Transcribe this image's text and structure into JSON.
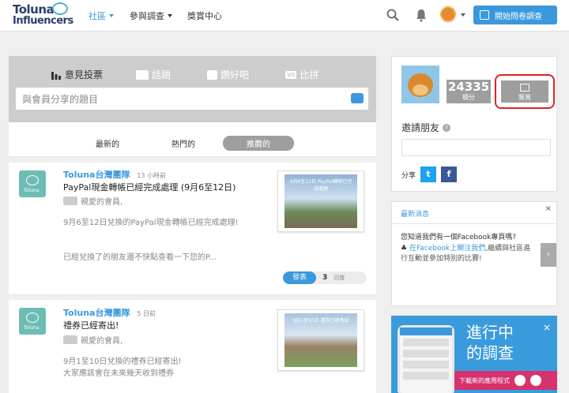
{
  "brand": {
    "line1": "Toluna",
    "line2": "Influencers"
  },
  "nav": {
    "items": [
      {
        "label": "社區"
      },
      {
        "label": "參與調查"
      },
      {
        "label": "獎賞中心"
      }
    ],
    "cta_label": "開始問卷調查"
  },
  "composer": {
    "tabs": [
      {
        "label": "意見投票"
      },
      {
        "label": "話題"
      },
      {
        "label": "讚好吧"
      },
      {
        "label": "比拼",
        "badge": "VS"
      }
    ],
    "placeholder": "與會員分享的題目"
  },
  "sort_tabs": [
    {
      "label": "最新的"
    },
    {
      "label": "熱門的"
    },
    {
      "label": "推薦的"
    }
  ],
  "posts": [
    {
      "author": "Toluna台灣團隊",
      "time": "13 小時前",
      "title": "PayPal現金轉帳已經完成處理 (9月6至12日)",
      "greeting": "親愛的會員,",
      "body1": "9月6至12日兌換的PayPal現金轉帳已經完成處理!",
      "body2": "已經兌換了的朋友還不快點查看一下您的P...",
      "thumb_caption": "9月6至12日 PayPal轉帳已完成處理",
      "publish_label": "發表",
      "comment_count": "3",
      "reply_label": "回覆"
    },
    {
      "author": "Toluna台灣團隊",
      "time": "5 日前",
      "title": "禮券已經寄出!",
      "greeting": "親愛的會員,",
      "body1": "9月1至10日兌換的禮券已經寄出!",
      "body2": "大家應該會在未來幾天收到禮券",
      "thumb_caption": "9月1至10日 禮券已經寄出"
    }
  ],
  "profile": {
    "points": "24335",
    "points_label": "積分",
    "reward_label": "獎賞",
    "invite_title": "邀請朋友",
    "help": "?",
    "share_label": "分享"
  },
  "news": {
    "heading": "最新消息",
    "close": "×",
    "question": "您知道我們有一個Facebook專頁嗎?",
    "link": "在Facebook上關注我們",
    "body": ",繼續與社區進行互動並參加特別的比賽!",
    "arrow": "›"
  },
  "promo": {
    "line1": "進行中",
    "line2": "的調查",
    "close": "×",
    "download": "下載新的應用程式"
  },
  "colors": {
    "accent": "#3b98dd",
    "reward_highlight": "#d22222",
    "promo_pink": "#d6326e"
  }
}
